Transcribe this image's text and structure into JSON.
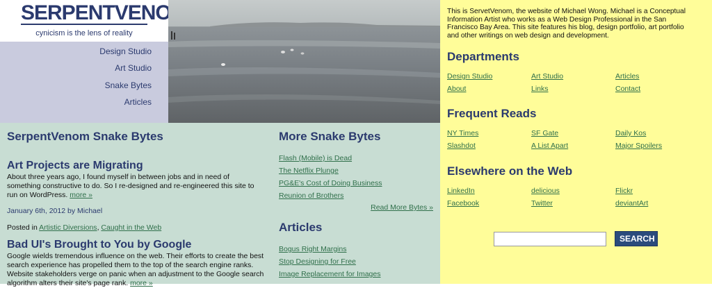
{
  "logo": {
    "text": "SERPENTVENOM",
    "tagline": "cynicism is the lens of reality"
  },
  "nav": {
    "items": [
      {
        "label": "Design Studio"
      },
      {
        "label": "Art Studio"
      },
      {
        "label": "Snake Bytes"
      },
      {
        "label": "Articles"
      }
    ]
  },
  "posts": {
    "heading": "SerpentVenom Snake Bytes",
    "items": [
      {
        "title": "Art Projects are Migrating",
        "body": "About three years ago, I found myself in between jobs and in need of something constructive to do. So I re-designed and re-engineered this site to run on WordPress.",
        "more": "more »",
        "date": "January 6th, 2012 by Michael",
        "posted_in": "Posted in",
        "categories": [
          "Artistic Diversions",
          "Caught in the Web"
        ]
      },
      {
        "title": "Bad UI's Brought to You by Google",
        "body": "Google wields tremendous influence on the web. Their efforts to create the best search experience has propelled them to the top of the search engine ranks. Website stakeholders verge on panic when an adjustment to the Google search algorithm alters their site's page rank.",
        "more": "more »"
      }
    ]
  },
  "more_bytes": {
    "heading": "More Snake Bytes",
    "links": [
      "Flash (Mobile) is Dead",
      "The Netflix Plunge",
      "PG&E's Cost of Doing Business",
      "Reunion of Brothers"
    ],
    "read_more": "Read More Bytes »"
  },
  "articles": {
    "heading": "Articles",
    "links": [
      "Bogus Right Margins",
      "Stop Designing for Free",
      "Image Replacement for Images"
    ]
  },
  "info": {
    "intro": "This is ServetVenom, the website of Michael Wong. Michael is a Conceptual Information Artist who works as a Web Design Professional in the San Francisco Bay Area. This site features his blog, design portfolio, art portfolio and other writings on web design and development.",
    "departments": {
      "heading": "Departments",
      "links": [
        "Design Studio",
        "Art Studio",
        "Articles",
        "About",
        "Links",
        "Contact"
      ]
    },
    "frequent": {
      "heading": "Frequent Reads",
      "links": [
        "NY Times",
        "SF Gate",
        "Daily Kos",
        "Slashdot",
        "A List Apart",
        "Major Spoilers"
      ]
    },
    "elsewhere": {
      "heading": "Elsewhere on the Web",
      "links": [
        "LinkedIn",
        "delicious",
        "Flickr",
        "Facebook",
        "Twitter",
        "deviantArt"
      ]
    }
  },
  "search": {
    "value": "",
    "button": "SEARCH"
  },
  "colors": {
    "brand": "#2b3a6e",
    "nav_bg": "#c9cbde",
    "main_bg": "#c8ddd3",
    "info_bg": "#fffd99",
    "link": "#2f6f4a"
  }
}
